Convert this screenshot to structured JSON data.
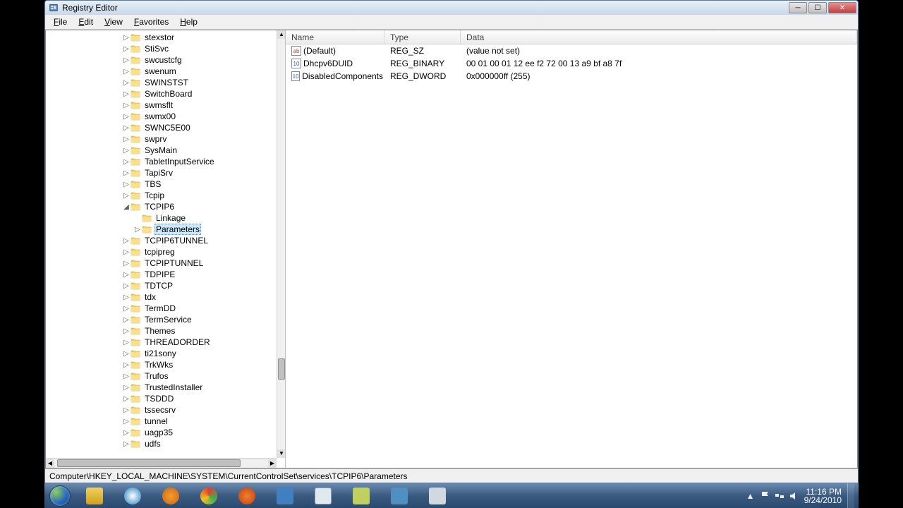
{
  "window": {
    "title": "Registry Editor"
  },
  "menu": {
    "file": "File",
    "edit": "Edit",
    "view": "View",
    "favorites": "Favorites",
    "help": "Help"
  },
  "tree": {
    "items": [
      {
        "label": "stexstor",
        "indent": 1,
        "exp": "▷"
      },
      {
        "label": "StiSvc",
        "indent": 1,
        "exp": "▷"
      },
      {
        "label": "swcustcfg",
        "indent": 1,
        "exp": "▷"
      },
      {
        "label": "swenum",
        "indent": 1,
        "exp": "▷"
      },
      {
        "label": "SWINSTST",
        "indent": 1,
        "exp": "▷"
      },
      {
        "label": "SwitchBoard",
        "indent": 1,
        "exp": "▷"
      },
      {
        "label": "swmsflt",
        "indent": 1,
        "exp": "▷"
      },
      {
        "label": "swmx00",
        "indent": 1,
        "exp": "▷"
      },
      {
        "label": "SWNC5E00",
        "indent": 1,
        "exp": "▷"
      },
      {
        "label": "swprv",
        "indent": 1,
        "exp": "▷"
      },
      {
        "label": "SysMain",
        "indent": 1,
        "exp": "▷"
      },
      {
        "label": "TabletInputService",
        "indent": 1,
        "exp": "▷"
      },
      {
        "label": "TapiSrv",
        "indent": 1,
        "exp": "▷"
      },
      {
        "label": "TBS",
        "indent": 1,
        "exp": "▷"
      },
      {
        "label": "Tcpip",
        "indent": 1,
        "exp": "▷"
      },
      {
        "label": "TCPIP6",
        "indent": 1,
        "exp": "◢",
        "expanded": true
      },
      {
        "label": "Linkage",
        "indent": 2,
        "exp": ""
      },
      {
        "label": "Parameters",
        "indent": 2,
        "exp": "▷",
        "selected": true
      },
      {
        "label": "TCPIP6TUNNEL",
        "indent": 1,
        "exp": "▷"
      },
      {
        "label": "tcpipreg",
        "indent": 1,
        "exp": "▷"
      },
      {
        "label": "TCPIPTUNNEL",
        "indent": 1,
        "exp": "▷"
      },
      {
        "label": "TDPIPE",
        "indent": 1,
        "exp": "▷"
      },
      {
        "label": "TDTCP",
        "indent": 1,
        "exp": "▷"
      },
      {
        "label": "tdx",
        "indent": 1,
        "exp": "▷"
      },
      {
        "label": "TermDD",
        "indent": 1,
        "exp": "▷"
      },
      {
        "label": "TermService",
        "indent": 1,
        "exp": "▷"
      },
      {
        "label": "Themes",
        "indent": 1,
        "exp": "▷"
      },
      {
        "label": "THREADORDER",
        "indent": 1,
        "exp": "▷"
      },
      {
        "label": "ti21sony",
        "indent": 1,
        "exp": "▷"
      },
      {
        "label": "TrkWks",
        "indent": 1,
        "exp": "▷"
      },
      {
        "label": "Trufos",
        "indent": 1,
        "exp": "▷"
      },
      {
        "label": "TrustedInstaller",
        "indent": 1,
        "exp": "▷"
      },
      {
        "label": "TSDDD",
        "indent": 1,
        "exp": "▷"
      },
      {
        "label": "tssecsrv",
        "indent": 1,
        "exp": "▷"
      },
      {
        "label": "tunnel",
        "indent": 1,
        "exp": "▷"
      },
      {
        "label": "uagp35",
        "indent": 1,
        "exp": "▷"
      },
      {
        "label": "udfs",
        "indent": 1,
        "exp": "▷"
      }
    ]
  },
  "list": {
    "headers": {
      "name": "Name",
      "type": "Type",
      "data": "Data"
    },
    "rows": [
      {
        "icon": "sz",
        "name": "(Default)",
        "type": "REG_SZ",
        "data": "(value not set)"
      },
      {
        "icon": "bin",
        "name": "Dhcpv6DUID",
        "type": "REG_BINARY",
        "data": "00 01 00 01 12 ee f2 72 00 13 a9 bf a8 7f"
      },
      {
        "icon": "bin",
        "name": "DisabledComponents",
        "type": "REG_DWORD",
        "data": "0x000000ff (255)"
      }
    ]
  },
  "statusbar": {
    "path": "Computer\\HKEY_LOCAL_MACHINE\\SYSTEM\\CurrentControlSet\\services\\TCPIP6\\Parameters"
  },
  "taskbar": {
    "time": "11:16 PM",
    "date": "9/24/2010"
  }
}
